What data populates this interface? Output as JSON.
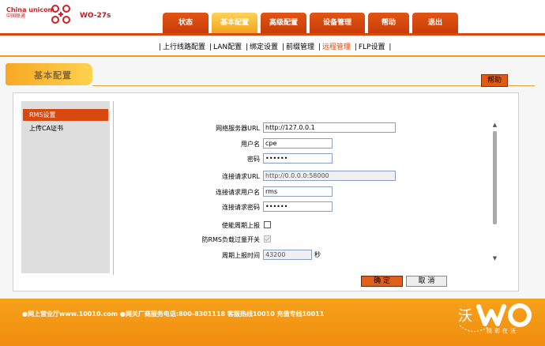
{
  "header": {
    "logo_en": "China unicom",
    "logo_cn": "中国联通",
    "model": "WO-27s"
  },
  "nav": {
    "tabs": [
      {
        "label": "状态",
        "active": false
      },
      {
        "label": "基本配置",
        "active": true
      },
      {
        "label": "高级配置",
        "active": false
      },
      {
        "label": "设备管理",
        "active": false
      },
      {
        "label": "帮助",
        "active": false
      },
      {
        "label": "退出",
        "active": false
      }
    ]
  },
  "subnav": {
    "items": [
      {
        "label": "上行线路配置",
        "active": false
      },
      {
        "label": "LAN配置",
        "active": false
      },
      {
        "label": "绑定设置",
        "active": false
      },
      {
        "label": "前缀管理",
        "active": false
      },
      {
        "label": "远程管理",
        "active": true
      },
      {
        "label": "FLP设置",
        "active": false
      }
    ]
  },
  "section": {
    "title": "基本配置",
    "help": "帮助"
  },
  "sidebar": {
    "items": [
      {
        "label": "RMS设置",
        "active": true
      },
      {
        "label": "上传CA证书",
        "active": false
      }
    ]
  },
  "form": {
    "server_url_label": "网络服务器URL",
    "server_url_value": "http://127.0.0.1",
    "username_label": "用户名",
    "username_value": "cpe",
    "password_label": "密码",
    "password_value": "••••••",
    "conn_url_label": "连接请求URL",
    "conn_url_value": "http://0.0.0.0:58000",
    "conn_user_label": "连接请求用户名",
    "conn_user_value": "rms",
    "conn_pass_label": "连接请求密码",
    "conn_pass_value": "••••••",
    "periodic_label": "使能周期上报",
    "overload_label": "防RMS负载过量开关",
    "interval_label": "周期上报时间",
    "interval_value": "43200",
    "interval_unit": "秒"
  },
  "buttons": {
    "ok": "确 定",
    "cancel": "取 消"
  },
  "footer": {
    "text": "●网上营业厅www.10010.com ●网关厂商服务电话:800-8301118 客服热线10010 充值专线10011",
    "slogan": "精彩在沃",
    "wo_char": "沃"
  },
  "colors": {
    "brand_red": "#d01e26",
    "nav_orange": "#d9480e",
    "accent_yellow": "#f6a11b"
  }
}
